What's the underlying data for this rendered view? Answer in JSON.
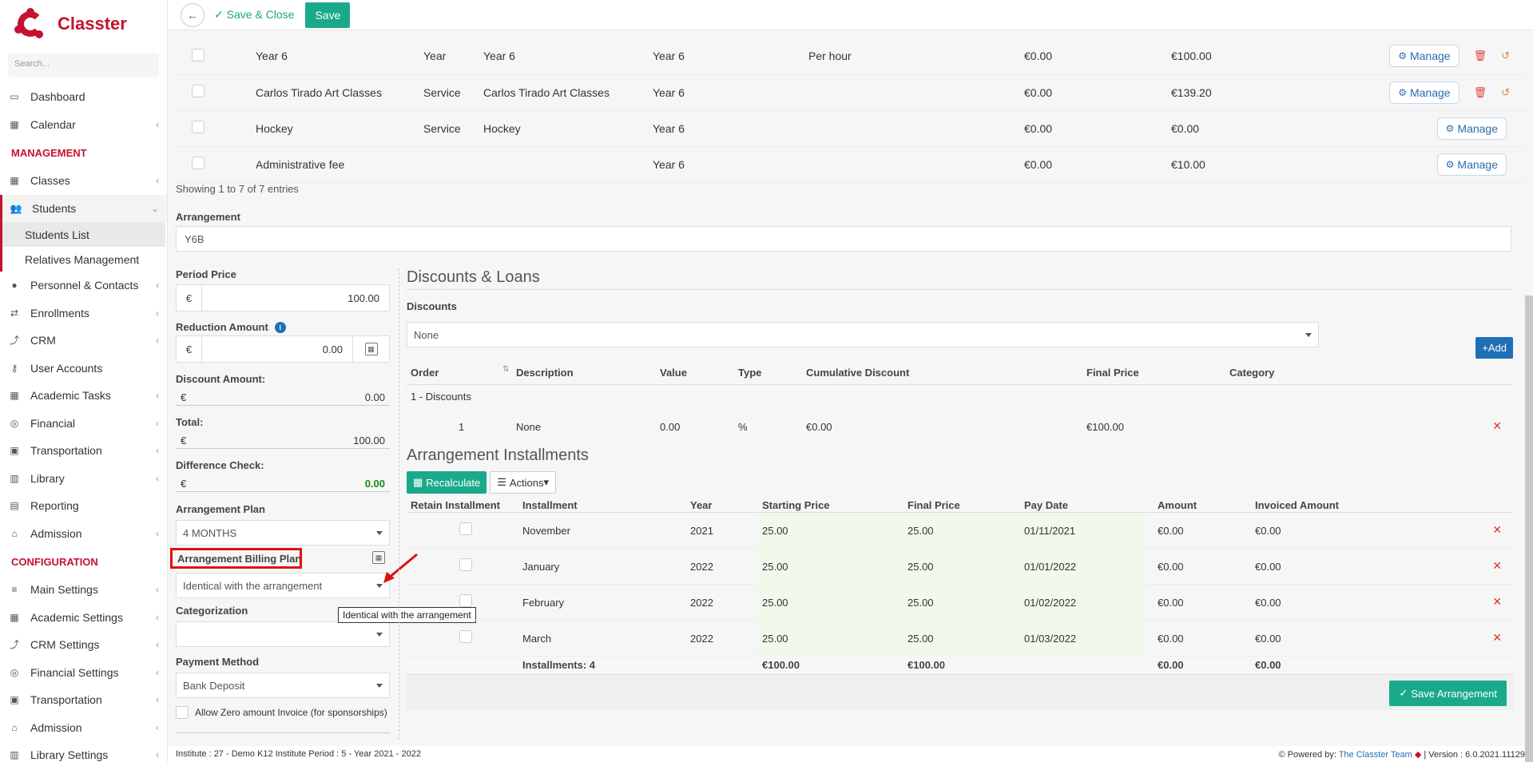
{
  "app": {
    "name": "Classter"
  },
  "sidebar": {
    "search_placeholder": "Search...",
    "items_top": [
      {
        "label": "Dashboard",
        "icon": "laptop-icon",
        "chev": false
      },
      {
        "label": "Calendar",
        "icon": "calendar-icon",
        "chev": true
      }
    ],
    "management_label": "MANAGEMENT",
    "management": [
      {
        "label": "Classes",
        "icon": "classes-icon",
        "chev": true
      },
      {
        "label": "Students",
        "icon": "students-icon",
        "chev": true,
        "active": true
      }
    ],
    "students_sub": [
      {
        "label": "Students List",
        "active": true
      },
      {
        "label": "Relatives Management",
        "active": false
      }
    ],
    "management_rest": [
      {
        "label": "Personnel & Contacts",
        "icon": "personnel-icon",
        "chev": true
      },
      {
        "label": "Enrollments",
        "icon": "enrollments-icon",
        "chev": true
      },
      {
        "label": "CRM",
        "icon": "crm-icon",
        "chev": true
      },
      {
        "label": "User Accounts",
        "icon": "key-icon",
        "chev": false
      },
      {
        "label": "Academic Tasks",
        "icon": "grid-icon",
        "chev": true
      },
      {
        "label": "Financial",
        "icon": "coins-icon",
        "chev": true
      },
      {
        "label": "Transportation",
        "icon": "bus-icon",
        "chev": true
      },
      {
        "label": "Library",
        "icon": "books-icon",
        "chev": true
      },
      {
        "label": "Reporting",
        "icon": "printer-icon",
        "chev": false
      },
      {
        "label": "Admission",
        "icon": "building-icon",
        "chev": true
      }
    ],
    "configuration_label": "CONFIGURATION",
    "configuration": [
      {
        "label": "Main Settings",
        "icon": "sliders-icon",
        "chev": true
      },
      {
        "label": "Academic Settings",
        "icon": "classes-icon",
        "chev": true
      },
      {
        "label": "CRM Settings",
        "icon": "crm-icon",
        "chev": true
      },
      {
        "label": "Financial Settings",
        "icon": "coins-icon",
        "chev": true
      },
      {
        "label": "Transportation",
        "icon": "bus-icon",
        "chev": true
      },
      {
        "label": "Admission",
        "icon": "building-icon",
        "chev": true
      },
      {
        "label": "Library Settings",
        "icon": "books-icon",
        "chev": true
      }
    ]
  },
  "toolbar": {
    "save_close": "Save & Close",
    "save": "Save"
  },
  "rows": [
    {
      "c1": "Year 6",
      "c2": "Year",
      "c3": "Year 6",
      "c4": "Year 6",
      "c5": "Per hour",
      "c6": "€0.00",
      "c7": "€100.00",
      "manage": "Manage",
      "extra": true
    },
    {
      "c1": "Carlos Tirado Art Classes",
      "c2": "Service",
      "c3": "Carlos Tirado Art Classes",
      "c4": "Year 6",
      "c5": "",
      "c6": "€0.00",
      "c7": "€139.20",
      "manage": "Manage",
      "extra": true
    },
    {
      "c1": "Hockey",
      "c2": "Service",
      "c3": "Hockey",
      "c4": "Year 6",
      "c5": "",
      "c6": "€0.00",
      "c7": "€0.00",
      "manage": "Manage",
      "extra": false
    },
    {
      "c1": "Administrative fee",
      "c2": "",
      "c3": "",
      "c4": "Year 6",
      "c5": "",
      "c6": "€0.00",
      "c7": "€10.00",
      "manage": "Manage",
      "extra": false
    }
  ],
  "showing": "Showing 1 to 7 of 7 entries",
  "arrangement": {
    "label": "Arrangement",
    "value": "Y6B"
  },
  "left": {
    "period_price_label": "Period Price",
    "currency": "€",
    "period_price": "100.00",
    "reduction_label": "Reduction Amount",
    "reduction": "0.00",
    "discount_label": "Discount Amount:",
    "discount": "0.00",
    "total_label": "Total:",
    "total": "100.00",
    "diff_label": "Difference Check:",
    "diff": "0.00",
    "plan_label": "Arrangement Plan",
    "plan": "4 MONTHS",
    "billing_label": "Arrangement Billing Plan",
    "billing": "Identical with the arrangement",
    "cat_label": "Categorization",
    "cat": "",
    "pay_label": "Payment Method",
    "pay": "Bank Deposit",
    "zero_label": "Allow Zero amount Invoice (for sponsorships)"
  },
  "tooltip": "Identical with the arrangement",
  "discounts": {
    "title": "Discounts & Loans",
    "label": "Discounts",
    "value": "None",
    "add": "Add",
    "headers": [
      "Order",
      "Description",
      "Value",
      "Type",
      "Cumulative Discount",
      "Final Price",
      "Category"
    ],
    "group": "1 - Discounts",
    "row": [
      "1",
      "None",
      "0.00",
      "%",
      "€0.00",
      "€100.00",
      ""
    ]
  },
  "installments": {
    "title": "Arrangement Installments",
    "recalc": "Recalculate",
    "actions": "Actions",
    "headers": [
      "Retain Installment",
      "Installment",
      "Year",
      "Starting Price",
      "Final Price",
      "Pay Date",
      "Amount",
      "Invoiced Amount"
    ],
    "rows": [
      [
        "November",
        "2021",
        "25.00",
        "25.00",
        "01/11/2021",
        "€0.00",
        "€0.00"
      ],
      [
        "January",
        "2022",
        "25.00",
        "25.00",
        "01/01/2022",
        "€0.00",
        "€0.00"
      ],
      [
        "February",
        "2022",
        "25.00",
        "25.00",
        "01/02/2022",
        "€0.00",
        "€0.00"
      ],
      [
        "March",
        "2022",
        "25.00",
        "25.00",
        "01/03/2022",
        "€0.00",
        "€0.00"
      ]
    ],
    "totals": [
      "Installments: 4",
      "€100.00",
      "€100.00",
      "€0.00",
      "€0.00"
    ],
    "save": "Save Arrangement"
  },
  "footer": {
    "left": "Institute : 27 - Demo K12 Institute Period : 5 - Year 2021 - 2022",
    "powered": "Powered by:",
    "team": "The Classter Team",
    "version": "| Version : 6.0.2021.11129"
  },
  "colors": {
    "brand": "#c41230",
    "green": "#1aaa8b",
    "blue": "#1f6fb7"
  }
}
